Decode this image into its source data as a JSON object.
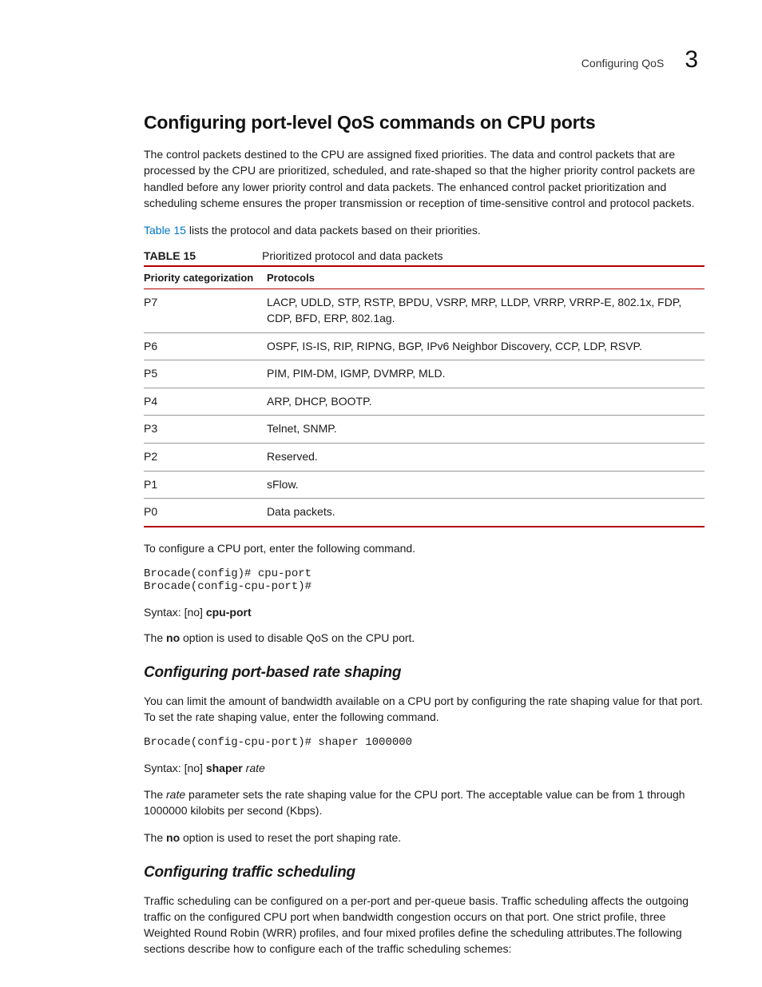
{
  "header": {
    "crumb": "Configuring QoS",
    "chapter": "3"
  },
  "h1": "Configuring port-level QoS commands on CPU ports",
  "p_intro": "The control packets destined to the CPU are assigned fixed priorities. The data and control packets that are processed by the CPU are prioritized, scheduled, and rate-shaped so that the higher priority control packets are handled before any lower priority control and data packets. The enhanced control packet prioritization and scheduling scheme ensures the proper transmission or reception of time-sensitive control and protocol packets.",
  "p_table_lead_link": "Table 15",
  "p_table_lead": " lists the protocol and data packets based on their priorities.",
  "table": {
    "label": "TABLE 15",
    "caption": "Prioritized protocol and data packets",
    "col1": "Priority categorization",
    "col2": "Protocols",
    "rows": [
      {
        "p": "P7",
        "v": "LACP, UDLD, STP, RSTP, BPDU, VSRP, MRP, LLDP, VRRP, VRRP-E, 802.1x, FDP, CDP, BFD, ERP, 802.1ag."
      },
      {
        "p": "P6",
        "v": "OSPF, IS-IS, RIP, RIPNG, BGP, IPv6 Neighbor Discovery, CCP, LDP, RSVP."
      },
      {
        "p": "P5",
        "v": "PIM, PIM-DM, IGMP, DVMRP, MLD."
      },
      {
        "p": "P4",
        "v": "ARP, DHCP, BOOTP."
      },
      {
        "p": "P3",
        "v": "Telnet, SNMP."
      },
      {
        "p": "P2",
        "v": "Reserved."
      },
      {
        "p": "P1",
        "v": "sFlow."
      },
      {
        "p": "P0",
        "v": "Data packets."
      }
    ]
  },
  "p_cfg_cpu": "To configure a CPU port, enter the following command.",
  "code_cpu": "Brocade(config)# cpu-port\nBrocade(config-cpu-port)#",
  "syntax_cpu_prefix": "Syntax:  ",
  "syntax_cpu_no": "[no] ",
  "syntax_cpu_cmd": "cpu-port",
  "p_no_cpu_a": "The ",
  "p_no_cpu_b": "no",
  "p_no_cpu_c": " option is used to disable QoS on the CPU port.",
  "h2_rate": "Configuring port-based rate shaping",
  "p_rate_intro": "You can limit the amount of bandwidth available on a CPU port by configuring the rate shaping value for that port. To set the rate shaping value, enter the following command.",
  "code_rate": "Brocade(config-cpu-port)# shaper 1000000",
  "syntax_shaper_prefix": "Syntax:  ",
  "syntax_shaper_no": "[no] ",
  "syntax_shaper_cmd": "shaper ",
  "syntax_shaper_arg": "rate",
  "p_rate_a": "The ",
  "p_rate_b": "rate",
  "p_rate_c": " parameter sets the rate shaping value for the CPU port. The acceptable value can be from 1 through 1000000 kilobits per second (Kbps).",
  "p_rate_no_a": "The ",
  "p_rate_no_b": "no",
  "p_rate_no_c": " option is used to reset the port shaping rate.",
  "h2_sched": "Configuring traffic scheduling",
  "p_sched": "Traffic scheduling can be configured on a per-port and per-queue basis. Traffic scheduling affects the outgoing traffic on the configured CPU port when bandwidth congestion occurs on that port. One strict profile, three Weighted Round Robin (WRR) profiles, and four mixed profiles define the scheduling attributes.The following sections describe how to configure each of the traffic scheduling schemes:"
}
